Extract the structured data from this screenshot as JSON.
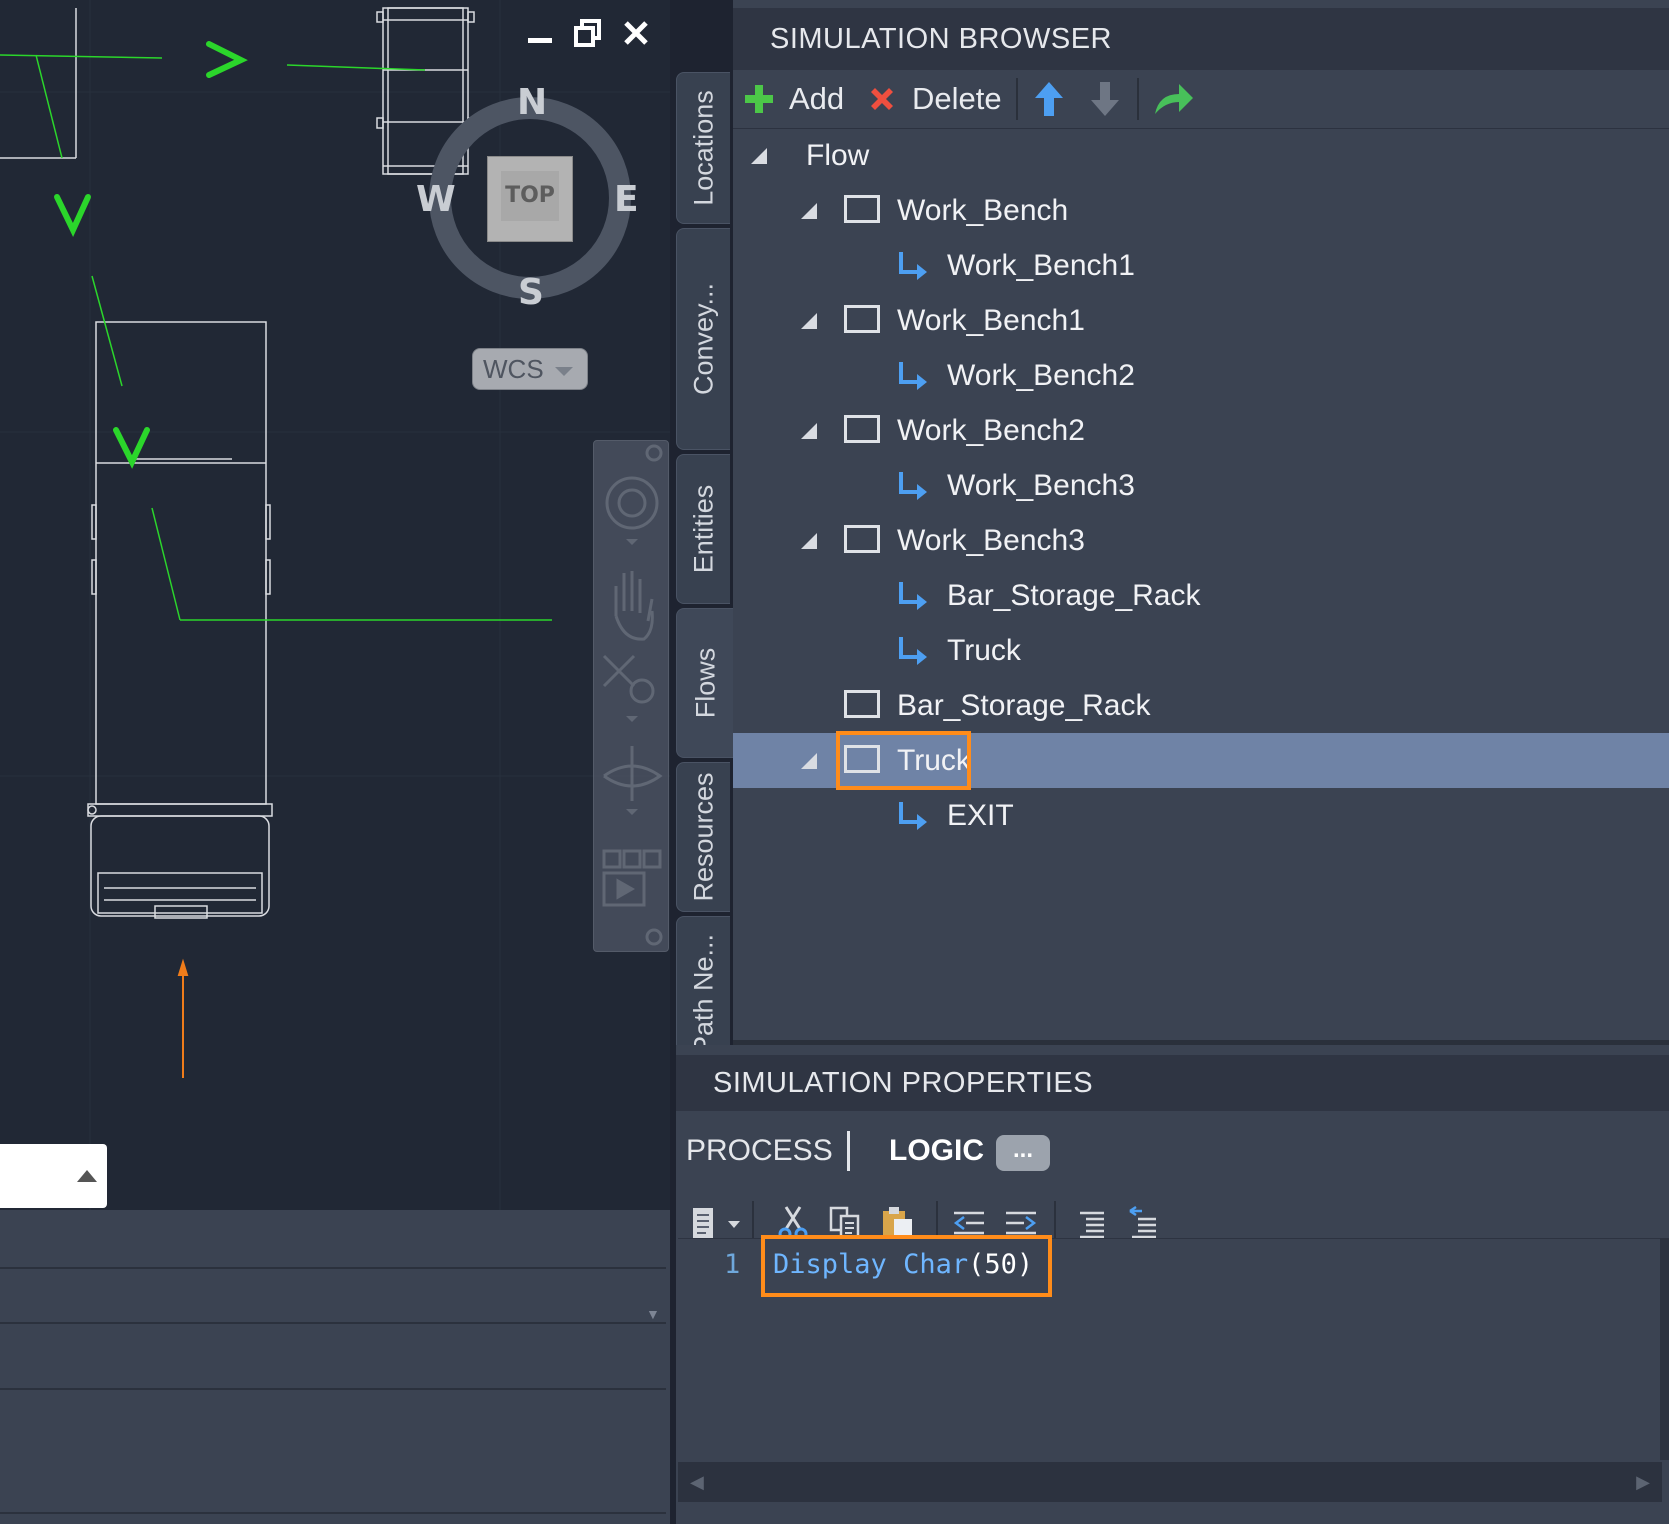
{
  "viewport": {
    "window_controls": [
      "minimize",
      "restore",
      "close"
    ],
    "viewcube": {
      "north": "N",
      "south": "S",
      "east": "E",
      "west": "W",
      "face": "TOP"
    },
    "wcs_label": "WCS",
    "flow_markers": [
      ">",
      "V",
      "V"
    ]
  },
  "simulation_browser": {
    "title": "SIMULATION BROWSER",
    "toolbar": {
      "add_label": "Add",
      "delete_label": "Delete",
      "move_up_icon": "arrow-up-icon",
      "move_down_icon": "arrow-down-icon",
      "forward_icon": "redo-arrow-icon"
    },
    "side_tabs": [
      "Locations",
      "Convey...",
      "Entities",
      "Flows",
      "Resources",
      "Path Ne..."
    ],
    "active_tab": "Flows",
    "tree": [
      {
        "label": "Flow",
        "type": "root",
        "expanded": true
      },
      {
        "label": "Work_Bench",
        "type": "location",
        "expanded": true
      },
      {
        "label": "Work_Bench1",
        "type": "route"
      },
      {
        "label": "Work_Bench1",
        "type": "location",
        "expanded": true
      },
      {
        "label": "Work_Bench2",
        "type": "route"
      },
      {
        "label": "Work_Bench2",
        "type": "location",
        "expanded": true
      },
      {
        "label": "Work_Bench3",
        "type": "route"
      },
      {
        "label": "Work_Bench3",
        "type": "location",
        "expanded": true
      },
      {
        "label": "Bar_Storage_Rack",
        "type": "route"
      },
      {
        "label": "Truck",
        "type": "route"
      },
      {
        "label": "Bar_Storage_Rack",
        "type": "location",
        "expanded": false
      },
      {
        "label": "Truck",
        "type": "location",
        "expanded": true,
        "selected": true
      },
      {
        "label": "EXIT",
        "type": "route"
      }
    ]
  },
  "simulation_properties": {
    "title": "SIMULATION PROPERTIES",
    "tabs": {
      "process": "PROCESS",
      "logic": "LOGIC",
      "more": "..."
    },
    "active_tab": "LOGIC",
    "editor": {
      "line_number": "1",
      "code_keyword_1": "Display",
      "code_keyword_2": "Char",
      "code_args": "(50)"
    }
  },
  "colors": {
    "highlight": "#ff8c1a",
    "selected_row": "#6f83a6",
    "panel_bg": "#3b4352",
    "viewport_bg": "#212835",
    "flow_green": "#2bd62b",
    "code_keyword": "#6fb6ff"
  }
}
